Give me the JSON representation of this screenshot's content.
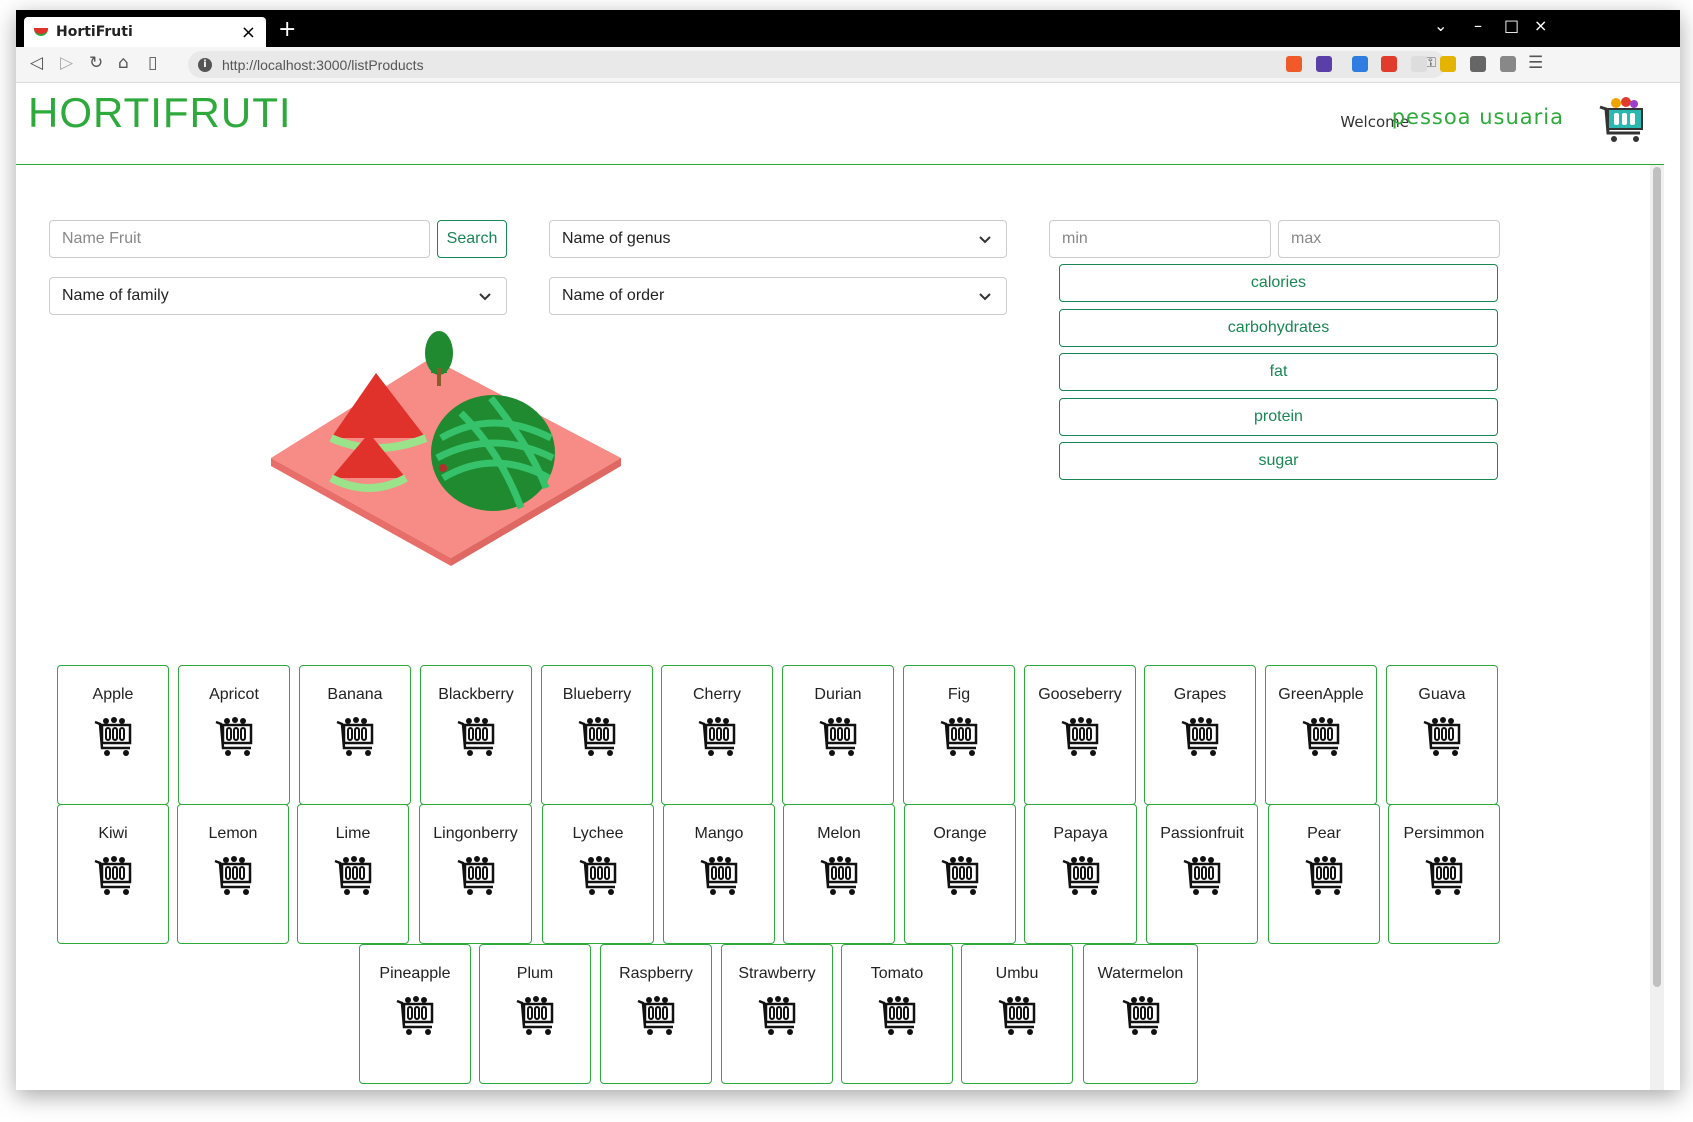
{
  "browser": {
    "tab_title": "HortiFruti",
    "url_host": "http://localhost",
    "url_path": ":3000/listProducts"
  },
  "header": {
    "logo": "HORTIFRUTI",
    "welcome": "Welcome",
    "username": "pessoa usuaria"
  },
  "filters": {
    "name_placeholder": "Name Fruit",
    "search_label": "Search",
    "genus": "Name of genus",
    "family": "Name of family",
    "order": "Name of order",
    "min_placeholder": "min",
    "max_placeholder": "max",
    "nutrients": [
      "calories",
      "carbohydrates",
      "fat",
      "protein",
      "sugar"
    ]
  },
  "products": [
    "Apple",
    "Apricot",
    "Banana",
    "Blackberry",
    "Blueberry",
    "Cherry",
    "Durian",
    "Fig",
    "Gooseberry",
    "Grapes",
    "GreenApple",
    "Guava",
    "Kiwi",
    "Lemon",
    "Lime",
    "Lingonberry",
    "Lychee",
    "Mango",
    "Melon",
    "Orange",
    "Papaya",
    "Passionfruit",
    "Pear",
    "Persimmon",
    "Pineapple",
    "Plum",
    "Raspberry",
    "Strawberry",
    "Tomato",
    "Umbu",
    "Watermelon"
  ],
  "colors": {
    "accent": "#2ea93c",
    "button": "#198754"
  }
}
